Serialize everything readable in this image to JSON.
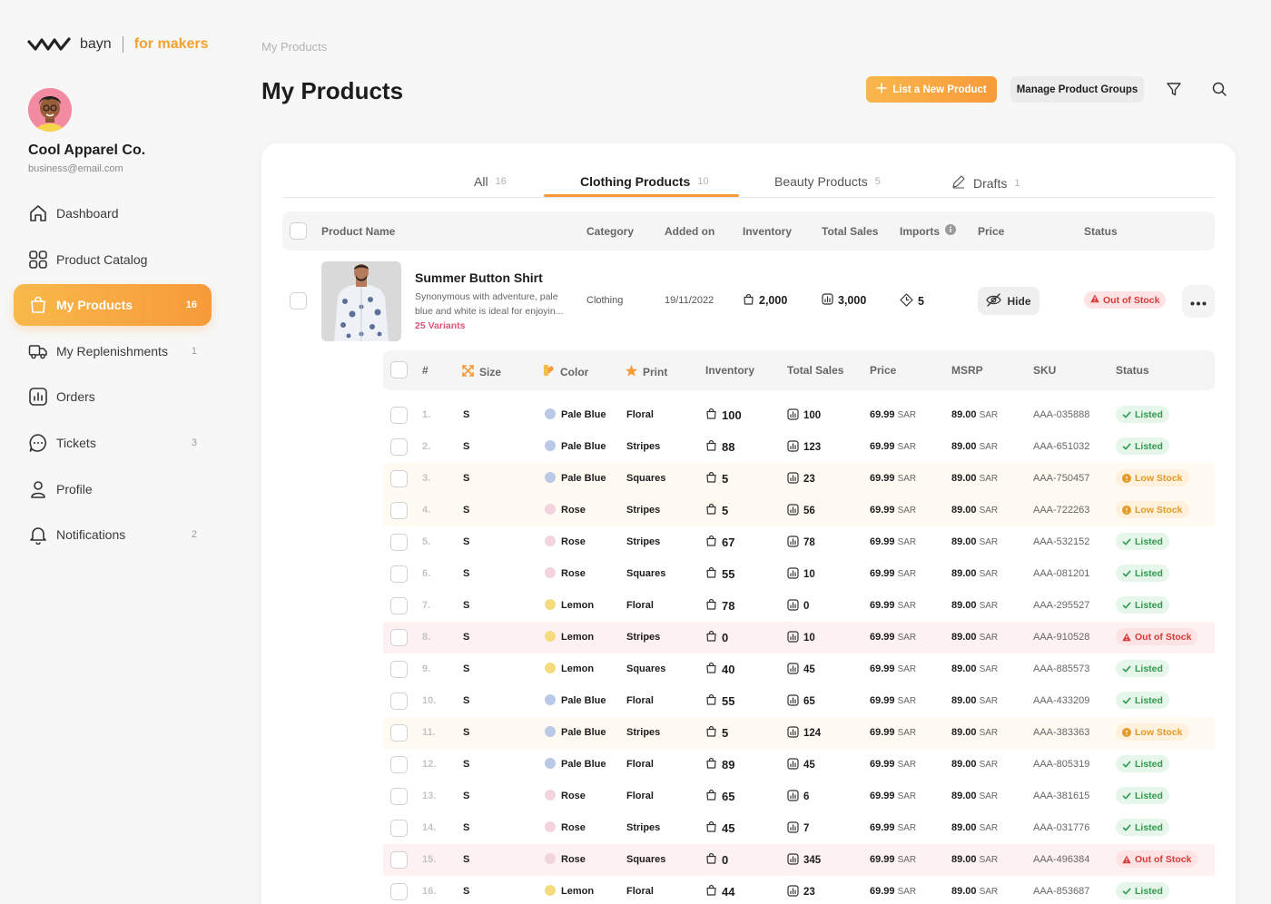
{
  "brand": {
    "name": "bayn",
    "tagline": "for makers"
  },
  "account": {
    "company": "Cool Apparel Co.",
    "email": "business@email.com"
  },
  "nav": [
    {
      "label": "Dashboard",
      "icon": "home-icon",
      "count": ""
    },
    {
      "label": "Product Catalog",
      "icon": "grid-icon",
      "count": ""
    },
    {
      "label": "My Products",
      "icon": "bag-icon",
      "count": "16",
      "active": true
    },
    {
      "label": "My Replenishments",
      "icon": "truck-icon",
      "count": "1"
    },
    {
      "label": "Orders",
      "icon": "chart-icon",
      "count": ""
    },
    {
      "label": "Tickets",
      "icon": "chat-icon",
      "count": "3"
    },
    {
      "label": "Profile",
      "icon": "user-icon",
      "count": ""
    },
    {
      "label": "Notifications",
      "icon": "bell-icon",
      "count": "2"
    }
  ],
  "header": {
    "breadcrumb": "My Products",
    "title": "My Products",
    "primary_button": "List a New Product",
    "secondary_button": "Manage Product Groups"
  },
  "tabs": [
    {
      "label": "All",
      "count": "16"
    },
    {
      "label": "Clothing Products",
      "count": "10",
      "active": true
    },
    {
      "label": "Beauty Products",
      "count": "5"
    },
    {
      "label": "Drafts",
      "count": "1"
    }
  ],
  "table_headers": {
    "product_name": "Product Name",
    "category": "Category",
    "added_on": "Added on",
    "inventory": "Inventory",
    "total_sales": "Total Sales",
    "imports": "Imports",
    "price": "Price",
    "status": "Status"
  },
  "product": {
    "name": "Summer Button Shirt",
    "description": "Synonymous with adventure, pale blue and white is ideal for enjoyin...",
    "variants": "25 Variants",
    "category": "Clothing",
    "added_on": "19/11/2022",
    "inventory": "2,000",
    "total_sales": "3,000",
    "imports": "5",
    "hide_label": "Hide",
    "status": "Out of Stock"
  },
  "variant_headers": {
    "index": "#",
    "size": "Size",
    "color": "Color",
    "print": "Print",
    "inventory": "Inventory",
    "total_sales": "Total Sales",
    "price": "Price",
    "msrp": "MSRP",
    "sku": "SKU",
    "status": "Status"
  },
  "currency": "SAR",
  "colors": {
    "accent": "#f79b3a",
    "listed": "#2f9c4f",
    "low": "#e49a26",
    "out": "#d93a3a",
    "Pale Blue": "#b9c9e6",
    "Rose": "#f3d3dc",
    "Lemon": "#f4dc7d"
  },
  "variants": [
    {
      "index": "1.",
      "size": "S",
      "color": "Pale Blue",
      "print": "Floral",
      "inventory": "100",
      "sales": "100",
      "price": "69.99",
      "msrp": "89.00",
      "sku": "AAA-035888",
      "status": "Listed",
      "kind": "listed"
    },
    {
      "index": "2.",
      "size": "S",
      "color": "Pale Blue",
      "print": "Stripes",
      "inventory": "88",
      "sales": "123",
      "price": "69.99",
      "msrp": "89.00",
      "sku": "AAA-651032",
      "status": "Listed",
      "kind": "listed"
    },
    {
      "index": "3.",
      "size": "S",
      "color": "Pale Blue",
      "print": "Squares",
      "inventory": "5",
      "sales": "23",
      "price": "69.99",
      "msrp": "89.00",
      "sku": "AAA-750457",
      "status": "Low Stock",
      "kind": "low"
    },
    {
      "index": "4.",
      "size": "S",
      "color": "Rose",
      "print": "Stripes",
      "inventory": "5",
      "sales": "56",
      "price": "69.99",
      "msrp": "89.00",
      "sku": "AAA-722263",
      "status": "Low Stock",
      "kind": "low"
    },
    {
      "index": "5.",
      "size": "S",
      "color": "Rose",
      "print": "Stripes",
      "inventory": "67",
      "sales": "78",
      "price": "69.99",
      "msrp": "89.00",
      "sku": "AAA-532152",
      "status": "Listed",
      "kind": "listed"
    },
    {
      "index": "6.",
      "size": "S",
      "color": "Rose",
      "print": "Squares",
      "inventory": "55",
      "sales": "10",
      "price": "69.99",
      "msrp": "89.00",
      "sku": "AAA-081201",
      "status": "Listed",
      "kind": "listed"
    },
    {
      "index": "7.",
      "size": "S",
      "color": "Lemon",
      "print": "Floral",
      "inventory": "78",
      "sales": "0",
      "price": "69.99",
      "msrp": "89.00",
      "sku": "AAA-295527",
      "status": "Listed",
      "kind": "listed"
    },
    {
      "index": "8.",
      "size": "S",
      "color": "Lemon",
      "print": "Stripes",
      "inventory": "0",
      "sales": "10",
      "price": "69.99",
      "msrp": "89.00",
      "sku": "AAA-910528",
      "status": "Out of Stock",
      "kind": "out"
    },
    {
      "index": "9.",
      "size": "S",
      "color": "Lemon",
      "print": "Squares",
      "inventory": "40",
      "sales": "45",
      "price": "69.99",
      "msrp": "89.00",
      "sku": "AAA-885573",
      "status": "Listed",
      "kind": "listed"
    },
    {
      "index": "10.",
      "size": "S",
      "color": "Pale Blue",
      "print": "Floral",
      "inventory": "55",
      "sales": "65",
      "price": "69.99",
      "msrp": "89.00",
      "sku": "AAA-433209",
      "status": "Listed",
      "kind": "listed"
    },
    {
      "index": "11.",
      "size": "S",
      "color": "Pale Blue",
      "print": "Stripes",
      "inventory": "5",
      "sales": "124",
      "price": "69.99",
      "msrp": "89.00",
      "sku": "AAA-383363",
      "status": "Low Stock",
      "kind": "low"
    },
    {
      "index": "12.",
      "size": "S",
      "color": "Pale Blue",
      "print": "Floral",
      "inventory": "89",
      "sales": "45",
      "price": "69.99",
      "msrp": "89.00",
      "sku": "AAA-805319",
      "status": "Listed",
      "kind": "listed"
    },
    {
      "index": "13.",
      "size": "S",
      "color": "Rose",
      "print": "Floral",
      "inventory": "65",
      "sales": "6",
      "price": "69.99",
      "msrp": "89.00",
      "sku": "AAA-381615",
      "status": "Listed",
      "kind": "listed"
    },
    {
      "index": "14.",
      "size": "S",
      "color": "Rose",
      "print": "Stripes",
      "inventory": "45",
      "sales": "7",
      "price": "69.99",
      "msrp": "89.00",
      "sku": "AAA-031776",
      "status": "Listed",
      "kind": "listed"
    },
    {
      "index": "15.",
      "size": "S",
      "color": "Rose",
      "print": "Squares",
      "inventory": "0",
      "sales": "345",
      "price": "69.99",
      "msrp": "89.00",
      "sku": "AAA-496384",
      "status": "Out of Stock",
      "kind": "out"
    },
    {
      "index": "16.",
      "size": "S",
      "color": "Lemon",
      "print": "Floral",
      "inventory": "44",
      "sales": "23",
      "price": "69.99",
      "msrp": "89.00",
      "sku": "AAA-853687",
      "status": "Listed",
      "kind": "listed"
    }
  ]
}
